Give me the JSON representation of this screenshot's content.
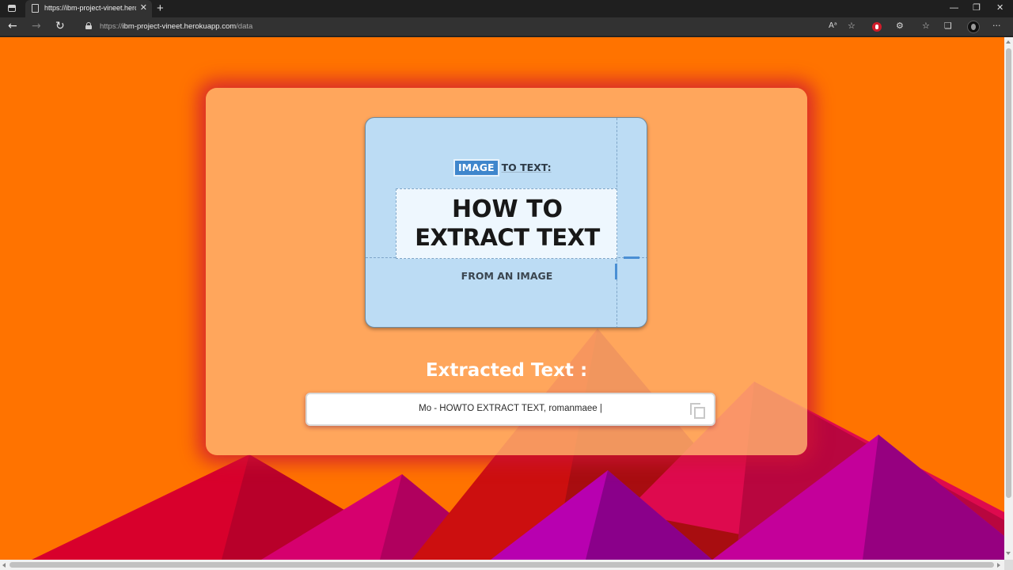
{
  "browser": {
    "tab_title": "https://ibm-project-vineet.herokuapp.com/data",
    "tab_close": "✕",
    "new_tab": "+",
    "url_scheme": "https://",
    "url_host": "ibm-project-vineet.herokuapp.com",
    "url_path": "/data",
    "window_controls": {
      "minimize": "—",
      "restore": "❐",
      "close": "✕"
    },
    "nav": {
      "back": "←",
      "forward": "→",
      "refresh": "↻"
    },
    "toolbar_icons": {
      "read_aloud": "Aᵃ",
      "add_favorite": "☆",
      "extensions": "⚙",
      "favorites": "☆",
      "collections": "❏",
      "more": "···"
    }
  },
  "page": {
    "colors": {
      "background": "#ff7300",
      "card": "#ffb06e",
      "card_glow": "#cd1437",
      "accent_blue": "#3f86cc"
    },
    "uploaded_image": {
      "tag": "IMAGE",
      "tag_after": "TO TEXT:",
      "headline_1": "HOW TO",
      "headline_2": "EXTRACT TEXT",
      "subline": "FROM AN IMAGE"
    },
    "extracted_label": "Extracted Text :",
    "extracted_text": "Mo - HOWTO EXTRACT TEXT, romanmaee |",
    "copy_icon": "copy-icon"
  }
}
